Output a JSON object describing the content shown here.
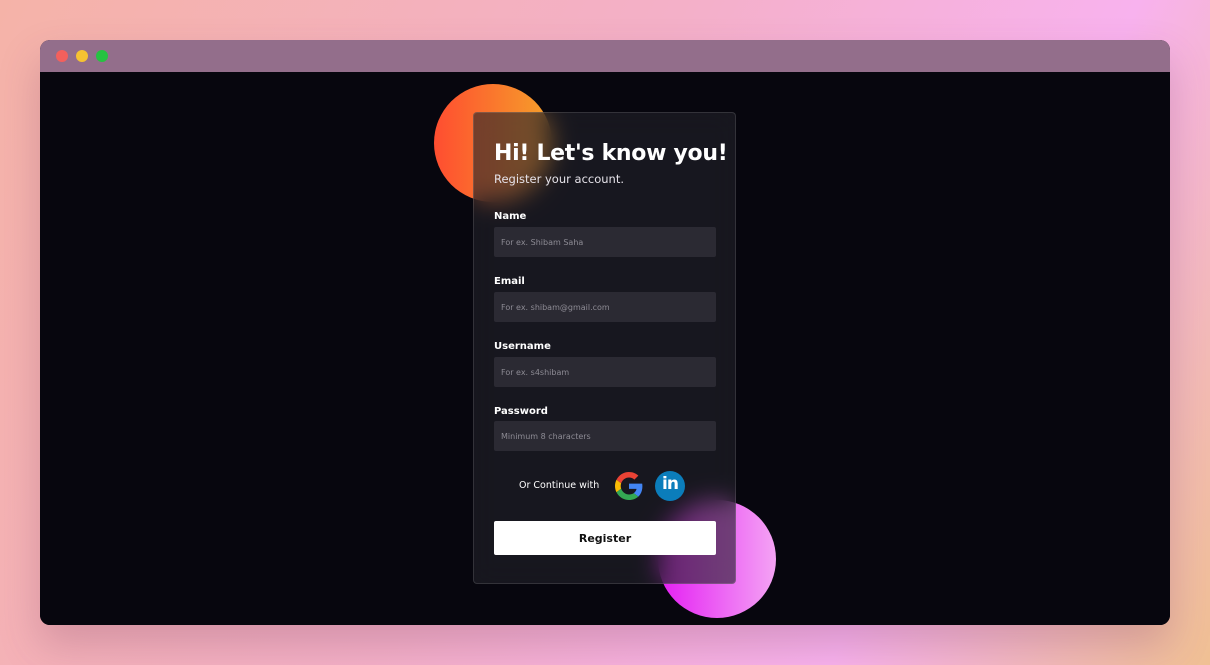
{
  "window": {
    "controls": [
      "close",
      "minimize",
      "maximize"
    ]
  },
  "form": {
    "title": "Hi! Let's know you!",
    "subtitle": "Register your account.",
    "fields": [
      {
        "label": "Name",
        "placeholder": "For ex. Shibam Saha",
        "value": ""
      },
      {
        "label": "Email",
        "placeholder": "For ex. shibam@gmail.com",
        "value": ""
      },
      {
        "label": "Username",
        "placeholder": "For ex. s4shibam",
        "value": ""
      },
      {
        "label": "Password",
        "placeholder": "Minimum 8 characters",
        "value": ""
      }
    ],
    "continue_text": "Or Continue with",
    "social": [
      {
        "name": "google-icon"
      },
      {
        "name": "linkedin-icon",
        "glyph": "in"
      }
    ],
    "submit_label": "Register"
  },
  "colors": {
    "window_bg": "#07060e",
    "titlebar": "#936e8b",
    "card_border": "#3a3942",
    "accent_orange": "#ff4d30",
    "accent_pink": "#e41df3"
  }
}
